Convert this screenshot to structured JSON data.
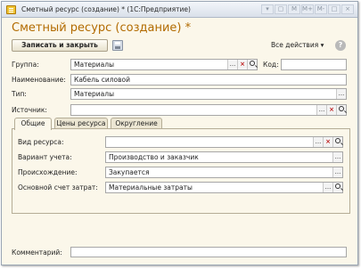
{
  "window": {
    "title": "Сметный ресурс (создание) * (1С:Предприятие)",
    "buttons": [
      "▾",
      "▢",
      "M",
      "M+",
      "M-",
      "□",
      "×"
    ]
  },
  "form": {
    "title": "Сметный ресурс (создание) *"
  },
  "toolbar": {
    "save_label": "Записать и закрыть",
    "all_actions_label": "Все действия ▾",
    "help_label": "?"
  },
  "fields": {
    "group": {
      "label": "Группа:",
      "value": "Материалы"
    },
    "code": {
      "label": "Код:",
      "value": ""
    },
    "name": {
      "label": "Наименование:",
      "value": "Кабель силовой"
    },
    "type": {
      "label": "Тип:",
      "value": "Материалы"
    },
    "source": {
      "label": "Источник:",
      "value": ""
    }
  },
  "tabs": [
    {
      "label": "Общие",
      "active": true
    },
    {
      "label": "Цены ресурса",
      "active": false
    },
    {
      "label": "Округление",
      "active": false
    }
  ],
  "general": {
    "resource_kind": {
      "label": "Вид ресурса:",
      "value": ""
    },
    "accounting_variant": {
      "label": "Вариант учета:",
      "value": "Производство и заказчик"
    },
    "origin": {
      "label": "Происхождение:",
      "value": "Закупается"
    },
    "cost_account": {
      "label": "Основной счет затрат:",
      "value": "Материальные затраты"
    }
  },
  "comment": {
    "label": "Комментарий:",
    "value": ""
  },
  "icons": {
    "choose": "...",
    "clear": "×"
  },
  "colors": {
    "form_title": "#b26b00",
    "background": "#fbf7ea",
    "clear_button": "#c02222"
  }
}
